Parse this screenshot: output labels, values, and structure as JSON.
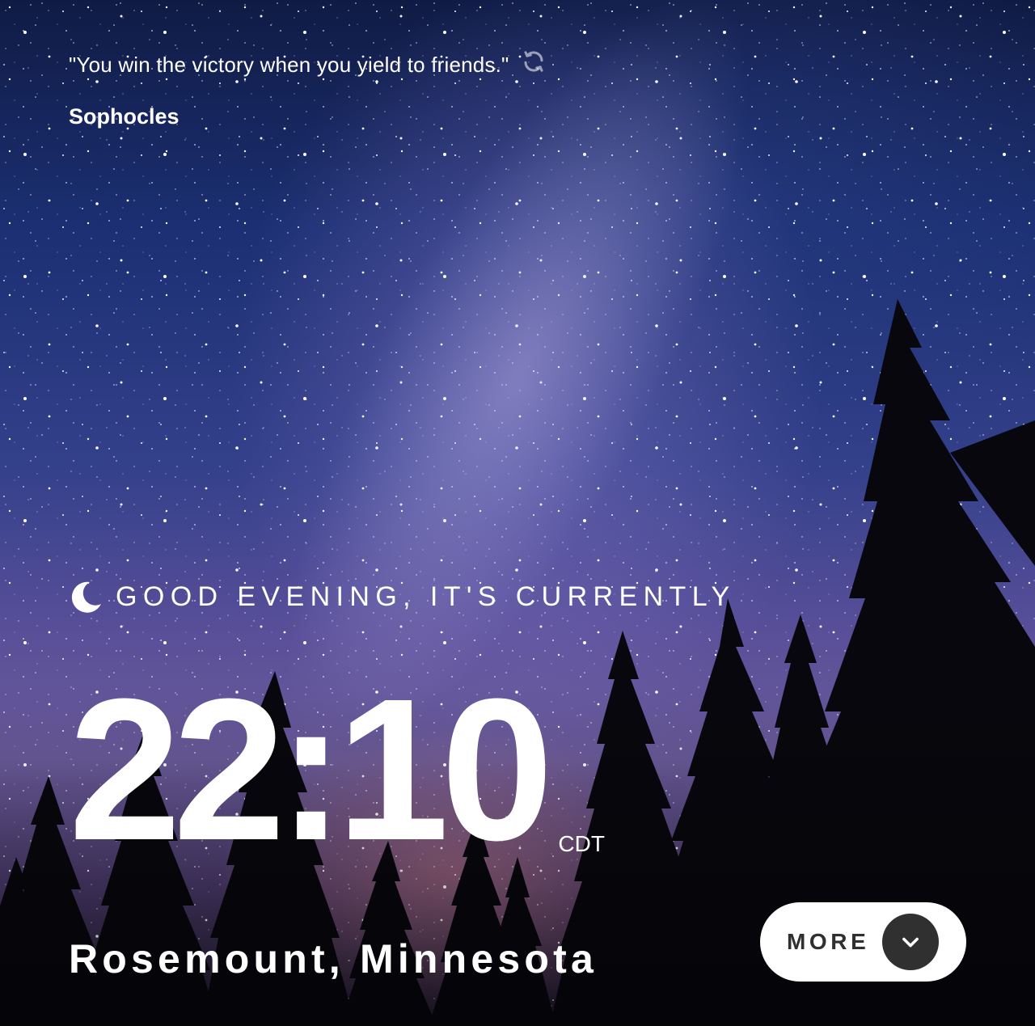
{
  "quote": {
    "text": "\"You win the victory when you yield to friends.\"",
    "author": "Sophocles",
    "refresh_icon": "refresh-icon"
  },
  "greeting": {
    "icon": "moon-icon",
    "text": "GOOD EVENING, IT'S CURRENTLY"
  },
  "clock": {
    "time": "22:10",
    "timezone": "CDT"
  },
  "location": {
    "text": "Rosemount, Minnesota"
  },
  "more_button": {
    "label": "MORE",
    "icon": "chevron-down-icon"
  },
  "colors": {
    "text": "#ffffff",
    "button_bg": "#ffffff",
    "button_text": "#303030",
    "chevron_circle": "#303030"
  }
}
